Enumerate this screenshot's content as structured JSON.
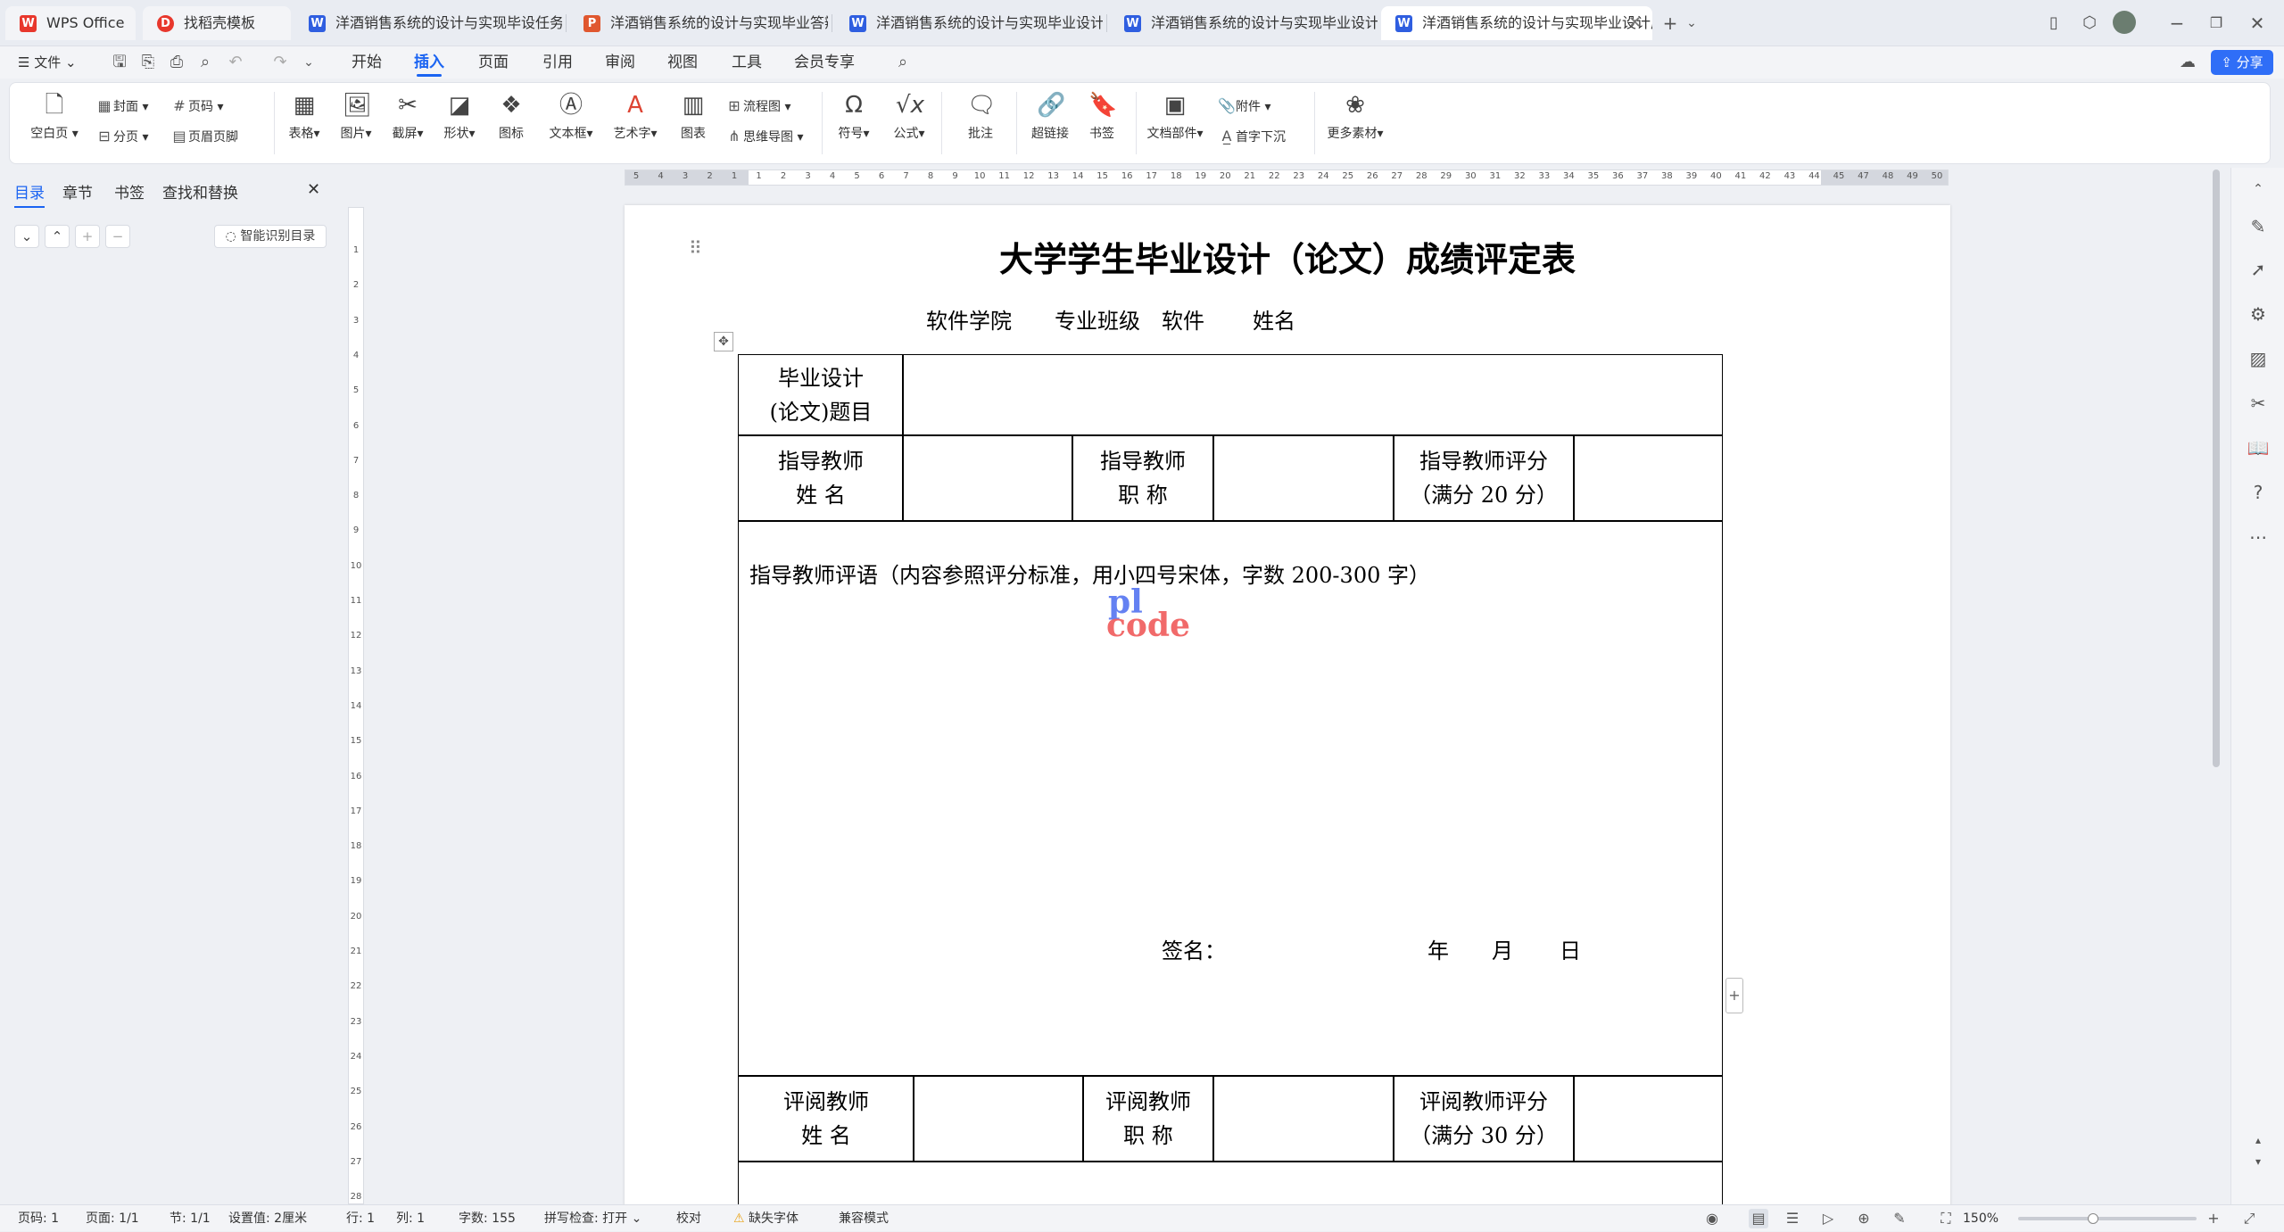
{
  "tabs": [
    {
      "label": "WPS Office",
      "icon": "wps-logo-icon",
      "color": "#e8372c"
    },
    {
      "label": "找稻壳模板",
      "icon": "docer-icon",
      "color": "#e8372c"
    },
    {
      "label": "洋酒销售系统的设计与实现毕设任务书",
      "icon": "word-doc-icon",
      "color": "#2f5ee0"
    },
    {
      "label": "洋酒销售系统的设计与实现毕业答辩ppt",
      "icon": "ppt-doc-icon",
      "color": "#e0572f"
    },
    {
      "label": "洋酒销售系统的设计与实现毕业设计论文",
      "icon": "word-doc-icon",
      "color": "#2f5ee0"
    },
    {
      "label": "洋酒销售系统的设计与实现毕业设计中期检查",
      "icon": "word-doc-icon",
      "color": "#2f5ee0"
    },
    {
      "label": "洋酒销售系统的设计与实现毕业设计成绩评定表",
      "icon": "word-doc-icon",
      "color": "#2f5ee0"
    }
  ],
  "menu": {
    "file": "文件",
    "items": [
      "开始",
      "插入",
      "页面",
      "引用",
      "审阅",
      "视图",
      "工具",
      "会员专享"
    ],
    "active": "插入",
    "share": "分享"
  },
  "ribbon": {
    "blank_page": "空白页",
    "cover": "封面",
    "page_break": "分页",
    "page_number": "页码",
    "header_footer": "页眉页脚",
    "table": "表格",
    "picture": "图片",
    "screenshot": "截屏",
    "shape": "形状",
    "icon": "图标",
    "textbox": "文本框",
    "wordart": "艺术字",
    "chart": "图表",
    "flowchart": "流程图",
    "mindmap": "思维导图",
    "symbol": "符号",
    "formula": "公式",
    "comment": "批注",
    "hyperlink": "超链接",
    "bookmark": "书签",
    "doc_parts": "文档部件",
    "attachment": "附件",
    "drop_cap": "首字下沉",
    "more_materials": "更多素材"
  },
  "leftpane": {
    "tabs": [
      "目录",
      "章节",
      "书签",
      "查找和替换"
    ],
    "active": "目录",
    "smart_toc": "智能识别目录"
  },
  "ruler": {
    "h_ticks": [
      "5",
      "4",
      "3",
      "2",
      "1",
      "1",
      "2",
      "3",
      "4",
      "5",
      "6",
      "7",
      "8",
      "9",
      "10",
      "11",
      "12",
      "13",
      "14",
      "15",
      "16",
      "17",
      "18",
      "19",
      "20",
      "21",
      "22",
      "23",
      "24",
      "25",
      "26",
      "27",
      "28",
      "29",
      "30",
      "31",
      "32",
      "33",
      "34",
      "35",
      "36",
      "37",
      "38",
      "39",
      "40",
      "41",
      "42",
      "43",
      "44",
      "45",
      "47",
      "48",
      "49",
      "50"
    ],
    "v_ticks": [
      "1",
      "2",
      "3",
      "4",
      "5",
      "6",
      "7",
      "8",
      "9",
      "10",
      "11",
      "12",
      "13",
      "14",
      "15",
      "16",
      "17",
      "18",
      "19",
      "20",
      "21",
      "22",
      "23",
      "24",
      "25",
      "26",
      "27",
      "28"
    ]
  },
  "document": {
    "title": "大学学生毕业设计（论文）成绩评定表",
    "college": "软件学院",
    "class_label": "专业班级",
    "class_value": "软件",
    "name_label": "姓名",
    "topic_line1": "毕业设计",
    "topic_line2": "(论文)题目",
    "advisor_name_1": "指导教师",
    "advisor_name_2": "姓  名",
    "advisor_title_1": "指导教师",
    "advisor_title_2": "职  称",
    "advisor_score_1": "指导教师评分",
    "advisor_score_2": "（满分 20 分）",
    "advisor_comment": "指导教师评语（内容参照评分标准，用小四号宋体，字数 200-300 字）",
    "sign": "签名：",
    "year": "年",
    "month": "月",
    "day": "日",
    "reviewer_name_1": "评阅教师",
    "reviewer_name_2": "姓  名",
    "reviewer_title_1": "评阅教师",
    "reviewer_title_2": "职  称",
    "reviewer_score_1": "评阅教师评分",
    "reviewer_score_2": "（满分 30 分）",
    "watermark_top": "pl",
    "watermark_bottom": "code"
  },
  "status": {
    "page": "页码: 1",
    "pages": "页面: 1/1",
    "section": "节: 1/1",
    "setting": "设置值: 2厘米",
    "row": "行: 1",
    "col": "列: 1",
    "words": "字数: 155",
    "spell": "拼写检查: 打开",
    "proof": "校对",
    "missing_font": "缺失字体",
    "compat": "兼容模式",
    "zoom": "150%"
  },
  "colors": {
    "accent": "#1b64f2",
    "share_bg": "#2f6ef7",
    "watermark_top": "#4a6cf0",
    "watermark_bottom": "#f05a5a"
  }
}
